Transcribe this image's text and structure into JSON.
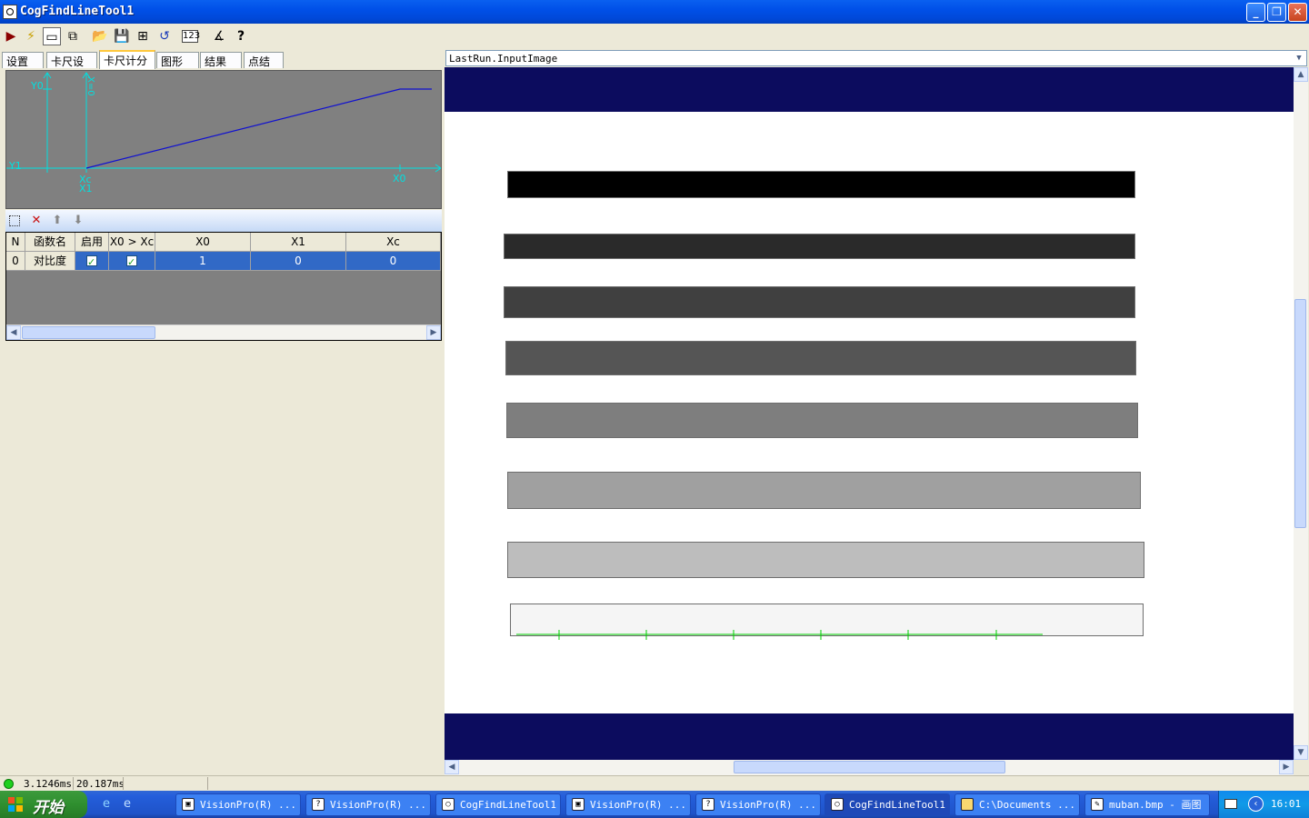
{
  "window": {
    "title": "CogFindLineTool1"
  },
  "tabs": [
    {
      "label": "设置",
      "active": false
    },
    {
      "label": "卡尺设置",
      "active": false
    },
    {
      "label": "卡尺计分",
      "active": true
    },
    {
      "label": "图形",
      "active": false
    },
    {
      "label": "结果",
      "active": false
    },
    {
      "label": "点结果",
      "active": false
    }
  ],
  "graph_labels": {
    "y0": "Y0",
    "y1": "Y1",
    "xc": "Xc",
    "x1": "X1",
    "x0": "X0",
    "xe": "X=0"
  },
  "grid": {
    "columns": [
      "N",
      "函数名",
      "启用",
      "X0 > Xc",
      "X0",
      "X1",
      "Xc"
    ],
    "rows": [
      {
        "n": "0",
        "name": "对比度",
        "enabled": true,
        "x0_gt_xc": true,
        "x0": "1",
        "x1": "0",
        "xc": "0"
      }
    ]
  },
  "image_display": {
    "selector_value": "LastRun.InputImage",
    "bar_shades": [
      "#000000",
      "#2a2a2a",
      "#404040",
      "#555555",
      "#7e7e7e",
      "#a0a0a0",
      "#bdbdbd",
      "#f5f5f5"
    ],
    "band_color": "#0c0c5e",
    "line_color": "#00d000"
  },
  "status": {
    "time1": "3.1246ms",
    "time2": "20.187ms"
  },
  "taskbar": {
    "start_label": "开始",
    "tasks": [
      {
        "label": "VisionPro(R) ...",
        "active": false
      },
      {
        "label": "VisionPro(R) ...",
        "active": false
      },
      {
        "label": "CogFindLineTool1",
        "active": false
      },
      {
        "label": "VisionPro(R) ...",
        "active": false
      },
      {
        "label": "VisionPro(R) ...",
        "active": false
      },
      {
        "label": "CogFindLineTool1",
        "active": true
      },
      {
        "label": "C:\\Documents ...",
        "active": false
      },
      {
        "label": "muban.bmp - 画图",
        "active": false
      }
    ],
    "clock": "16:01"
  }
}
